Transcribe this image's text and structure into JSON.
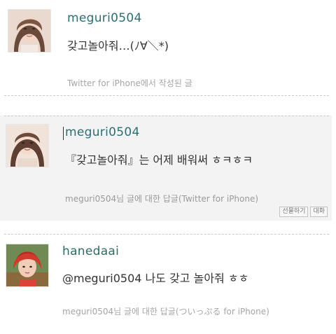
{
  "tweets": [
    {
      "username": "meguri0504",
      "text": "갖고놀아줘…(ﾉ∀＼*)",
      "meta": "Twitter for iPhone에서 작성된 글"
    },
    {
      "username": "meguri0504",
      "text": "『갖고놀아줘』는 어제 배워써 ㅎㅋㅎㅋ",
      "meta": "meguri0504님 글에 대한 답글(Twitter for iPhone)",
      "actions": {
        "gift_label": "선물하기",
        "conversation_label": "대화"
      }
    },
    {
      "username": "hanedaai",
      "text": "@meguri0504 나도 갖고 놀아줘 ㅎㅎ",
      "meta": "meguri0504님 글에 대한 답글(ついっぷる for iPhone)"
    }
  ],
  "colors": {
    "username": "#2b6f73",
    "meta": "#a5a5a5",
    "highlight_row": "#f3f3f3"
  }
}
